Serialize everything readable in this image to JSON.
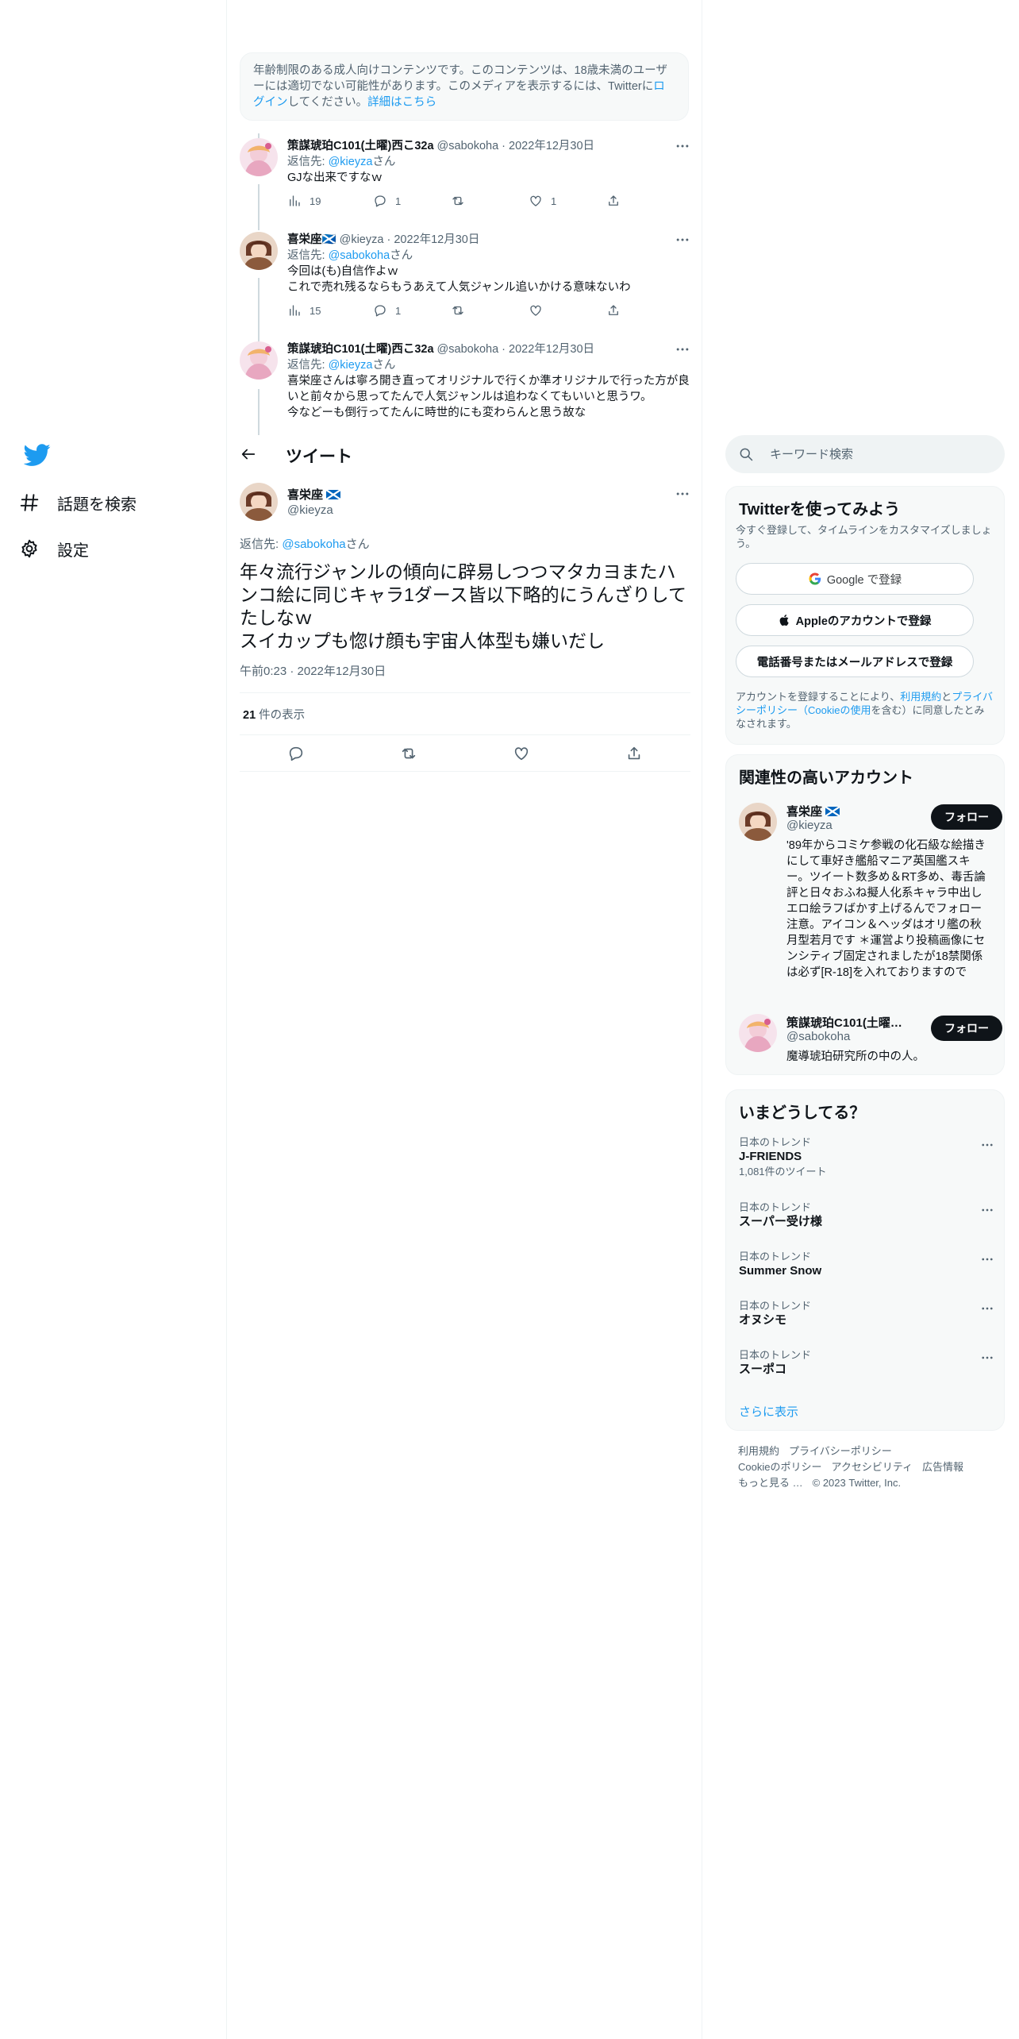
{
  "nav": {
    "explore_label": "話題を検索",
    "settings_label": "設定"
  },
  "warning": {
    "text_before": "年齢制限のある成人向けコンテンツです。このコンテンツは、18歳未満のユーザーには適切でない可能性があります。このメディアを表示するには、Twitterに",
    "login_link": "ログイン",
    "text_middle": "してください。",
    "details_link": "詳細はこちら"
  },
  "thread": [
    {
      "name": "策謀琥珀C101(土曜)西こ32a",
      "handle": "@sabokoha",
      "date": "2022年12月30日",
      "reply_prefix": "返信先: ",
      "reply_to": "@kieyza",
      "reply_suffix": "さん",
      "text": "GJな出来ですなｗ",
      "views": "19",
      "replies": "1",
      "retweets": "",
      "likes": "1"
    },
    {
      "name": "喜栄座🏴󠁧󠁢󠁳󠁣󠁴󠁿",
      "handle": "@kieyza",
      "date": "2022年12月30日",
      "reply_prefix": "返信先: ",
      "reply_to": "@sabokoha",
      "reply_suffix": "さん",
      "text": "今回は(も)自信作よｗ\nこれで売れ残るならもうあえて人気ジャンル追いかける意味ないわ",
      "views": "15",
      "replies": "1",
      "retweets": "",
      "likes": ""
    },
    {
      "name": "策謀琥珀C101(土曜)西こ32a",
      "handle": "@sabokoha",
      "date": "2022年12月30日",
      "reply_prefix": "返信先: ",
      "reply_to": "@kieyza",
      "reply_suffix": "さん",
      "text": "喜栄座さんは寧ろ開き直ってオリジナルで行くか準オリジナルで行った方が良いと前々から思ってたんで人気ジャンルは追わなくてもいいと思うワ。\n今などーも倒行ってたんに時世的にも変わらんと思う故な"
    }
  ],
  "header": {
    "title": "ツイート"
  },
  "main_tweet": {
    "name": "喜栄座",
    "handle": "@kieyza",
    "reply_prefix": "返信先: ",
    "reply_to": "@sabokoha",
    "reply_suffix": "さん",
    "text": "年々流行ジャンルの傾向に辟易しつつマタカヨまたハンコ絵に同じキャラ1ダース皆以下略的にうんざりしてたしなｗ\nスイカップも惚け顔も宇宙人体型も嫌いだし",
    "time": "午前0:23 · 2022年12月30日",
    "views_count": "21",
    "views_label": " 件の表示"
  },
  "search": {
    "placeholder": "キーワード検索"
  },
  "signup": {
    "title": "Twitterを使ってみよう",
    "subtitle": "今すぐ登録して、タイムラインをカスタマイズしましょう。",
    "google_label": "Google で登録",
    "apple_label": "Appleのアカウントで登録",
    "phone_label": "電話番号またはメールアドレスで登録",
    "legal_1": "アカウントを登録することにより、",
    "legal_terms": "利用規約",
    "legal_2": "と",
    "legal_privacy": "プライバシーポリシー（Cookieの使用",
    "legal_3": "を含む）に同意したとみなされます。"
  },
  "related": {
    "title": "関連性の高いアカウント",
    "accounts": [
      {
        "name": "喜栄座",
        "handle": "@kieyza",
        "follow_label": "フォロー",
        "bio": "'89年からコミケ参戦の化石級な絵描きにして車好き艦船マニア英国艦スキー。ツイート数多め＆RT多め、毒舌論評と日々おふね擬人化系キャラ中出しエロ絵ラフばかす上げるんでフォロー注意。アイコン＆ヘッダはオリ艦の秋月型若月です ＊運営より投稿画像にセンシティブ固定されましたが18禁関係は必ず[R-18]を入れておりますので"
      },
      {
        "name": "策謀琥珀C101(土曜)西こ32a",
        "handle": "@sabokoha",
        "follow_label": "フォロー",
        "bio": "魔導琥珀研究所の中の人。"
      }
    ]
  },
  "trends": {
    "title": "いまどうしてる？",
    "items": [
      {
        "label": "日本のトレンド",
        "name": "J-FRIENDS",
        "count": "1,081件のツイート"
      },
      {
        "label": "日本のトレンド",
        "name": "スーパー受け様",
        "count": ""
      },
      {
        "label": "日本のトレンド",
        "name": "Summer Snow",
        "count": ""
      },
      {
        "label": "日本のトレンド",
        "name": "オヌシモ",
        "count": ""
      },
      {
        "label": "日本のトレンド",
        "name": "スーポコ",
        "count": ""
      }
    ],
    "show_more": "さらに表示"
  },
  "footer": {
    "terms": "利用規約",
    "privacy": "プライバシーポリシー",
    "cookies": "Cookieのポリシー",
    "accessibility": "アクセシビリティ",
    "ads": "広告情報",
    "more": "もっと見る …",
    "copyright": "© 2023 Twitter, Inc."
  },
  "colors": {
    "accent": "#1d9bf0",
    "text": "#0f1419",
    "muted": "#536471",
    "border": "#eff3f4"
  }
}
